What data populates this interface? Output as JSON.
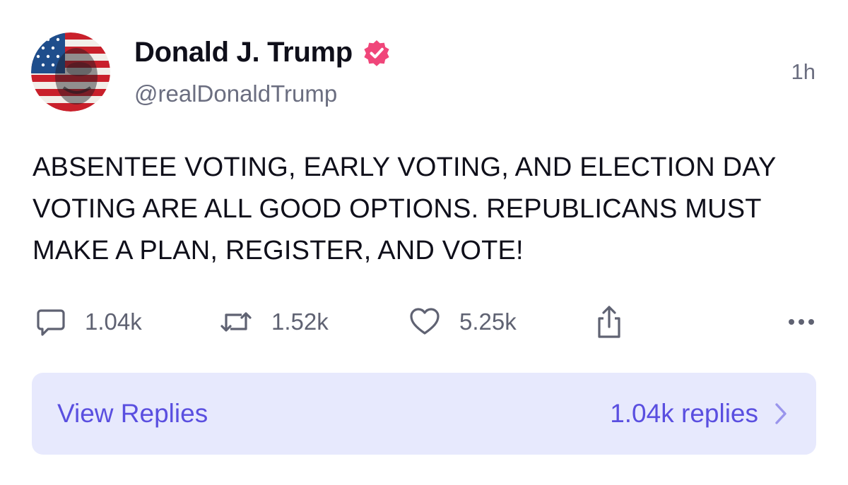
{
  "author": {
    "display_name": "Donald J. Trump",
    "handle": "@realDonaldTrump",
    "verified": true
  },
  "post": {
    "time": "1h",
    "text": "ABSENTEE VOTING, EARLY VOTING, AND ELECTION DAY VOTING ARE ALL GOOD OPTIONS. REPUBLICANS MUST MAKE A PLAN, REGISTER, AND VOTE!"
  },
  "actions": {
    "replies": "1.04k",
    "reposts": "1.52k",
    "likes": "5.25k"
  },
  "replies_bar": {
    "label": "View Replies",
    "count": "1.04k replies"
  },
  "icons": {
    "reply": "speech-bubble-icon",
    "repost": "repost-arrows-icon",
    "like": "heart-icon",
    "share": "share-icon",
    "more": "more-dots-icon",
    "verified": "verified-badge-icon",
    "chevron": "chevron-right-icon"
  },
  "colors": {
    "accent": "#5a4fe0",
    "verified_badge": "#f0467a",
    "replies_bar_bg": "#e7e9fd",
    "muted_text": "#6b6e80"
  }
}
